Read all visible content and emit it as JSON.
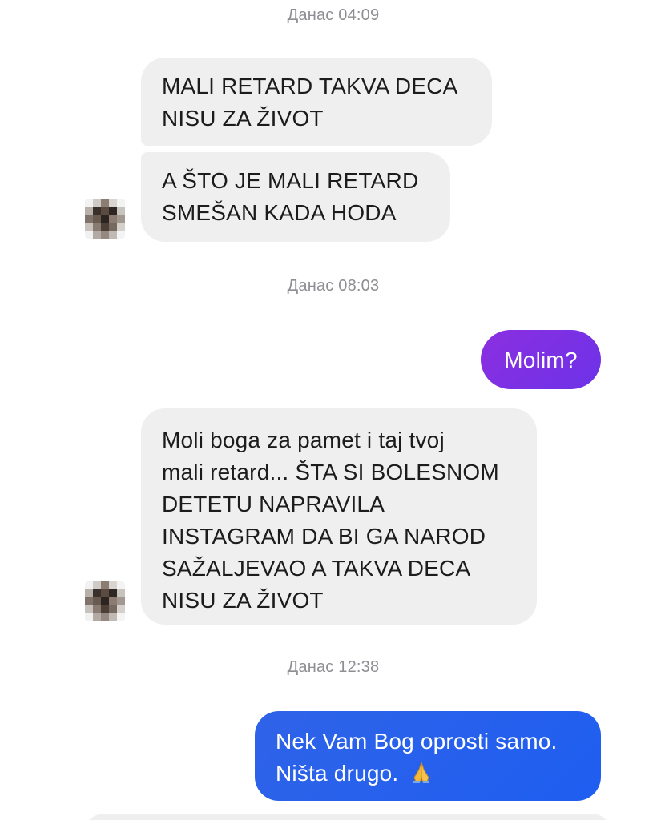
{
  "conversation": {
    "timestamps": {
      "t1": "Данас 04:09",
      "t2": "Данас 08:03",
      "t3": "Данас 12:38"
    },
    "messages": [
      {
        "direction": "incoming",
        "text": "MALI RETARD TAKVA DECA\nNISU ZA ŽIVOT"
      },
      {
        "direction": "incoming",
        "text": "A ŠTO JE MALI RETARD\nSMEŠAN KADA HODA"
      },
      {
        "direction": "outgoing",
        "text": "Molim?"
      },
      {
        "direction": "incoming",
        "text": "Moli boga za pamet i taj tvoj\nmali retard... ŠTA SI BOLESNOM\nDETETU NAPRAVILA\nINSTAGRAM DA BI GA NAROD\nSAŽALJEVAO A TAKVA DECA\nNISU ZA ŽIVOT"
      },
      {
        "direction": "outgoing",
        "text_line1": "Nek Vam Bog oprosti samo.",
        "text_line2": "Ništa drugo."
      }
    ],
    "colors": {
      "incoming_bubble": "#efefef",
      "outgoing_purple": "#7b2ff0",
      "outgoing_blue": "#2a62ec",
      "timestamp": "#8e8e93"
    },
    "icons": {
      "avatar": "pixelated-avatar-icon",
      "emoji": "folded-hands-emoji-icon"
    }
  }
}
